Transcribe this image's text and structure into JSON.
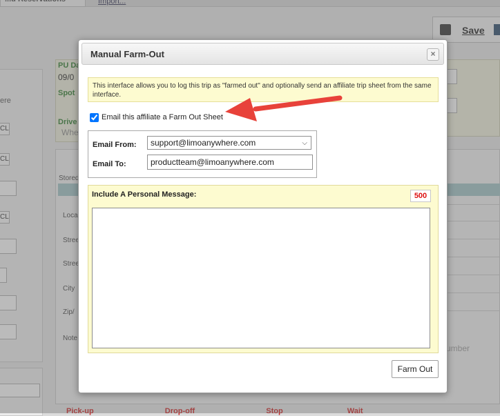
{
  "background": {
    "tab_label": "...d Reservations",
    "tab2_label": "Import...",
    "save_label": "Save",
    "left_text": "ere",
    "left_btn_text": "CL",
    "pu_date_label": "PU Da",
    "pu_date_value": "09/0",
    "spot_label": "Spot",
    "driver_label": "Drive",
    "driver_value": "Whe",
    "stored_label": "Stored",
    "loc_label": "Loca",
    "street1_label": "Stree",
    "street2_label": "Stree",
    "city_label": "City",
    "zip_label": "Zip/",
    "notes_label": "Note",
    "number_placeholder": "umber",
    "bottom_labels": [
      "Pick-up",
      "Drop-off",
      "Stop",
      "Wait"
    ]
  },
  "modal": {
    "title": "Manual Farm-Out",
    "close_label": "×",
    "info_text": "This interface allows you to log this trip as \"farmed out\" and optionally send an affiliate trip sheet from the same interface.",
    "email_checkbox_label": "Email this affiliate a Farm Out Sheet",
    "email_checkbox_checked": true,
    "email_from_label": "Email From:",
    "email_from_value": "support@limoanywhere.com",
    "email_to_label": "Email To:",
    "email_to_value": "productteam@limoanywhere.com",
    "message_label": "Include A Personal Message:",
    "char_count": "500",
    "message_value": "",
    "farm_out_label": "Farm Out"
  },
  "colors": {
    "info_bg": "#fdfbd0",
    "arrow": "#e8423a",
    "char_count": "#dd1111"
  }
}
